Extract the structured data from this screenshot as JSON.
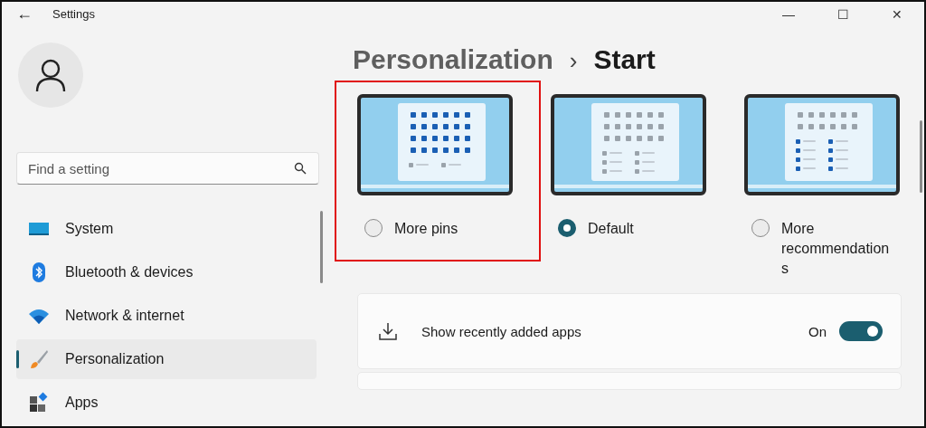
{
  "window": {
    "title": "Settings",
    "back": "←",
    "controls": [
      "—",
      "☐",
      "✕"
    ]
  },
  "search": {
    "placeholder": "Find a setting"
  },
  "sidebar": {
    "items": [
      {
        "label": "System",
        "kind": "system",
        "selected": false
      },
      {
        "label": "Bluetooth & devices",
        "kind": "bluetooth",
        "selected": false
      },
      {
        "label": "Network & internet",
        "kind": "network",
        "selected": false
      },
      {
        "label": "Personalization",
        "kind": "brush",
        "selected": true
      },
      {
        "label": "Apps",
        "kind": "apps",
        "selected": false
      }
    ]
  },
  "breadcrumb": {
    "parent": "Personalization",
    "separator": "›",
    "current": "Start"
  },
  "layouts": [
    {
      "label": "More pins",
      "kind": "pins",
      "selected": false,
      "highlighted": true
    },
    {
      "label": "Default",
      "kind": "default",
      "selected": true,
      "highlighted": false
    },
    {
      "label": "More recommendations",
      "kind": "recommendations",
      "selected": false,
      "highlighted": false
    }
  ],
  "settings": [
    {
      "label": "Show recently added apps",
      "state": "On",
      "on": true
    }
  ]
}
